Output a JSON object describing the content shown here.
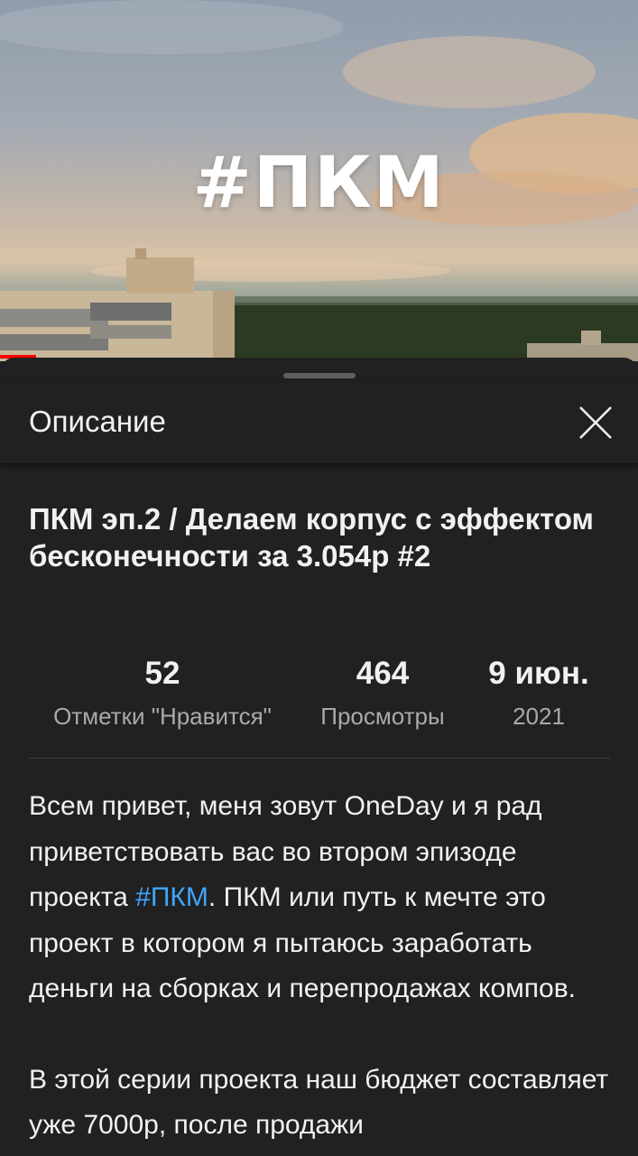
{
  "video": {
    "overlay_title": "#ПКМ",
    "progress_fraction": 0.056
  },
  "sheet": {
    "title": "Описание",
    "close_icon": "close-icon"
  },
  "video_title": "ПКМ эп.2 / Делаем корпус с эффектом бесконечности за 3.054р #2",
  "stats": {
    "likes": {
      "value": "52",
      "label": "Отметки \"Нравится\""
    },
    "views": {
      "value": "464",
      "label": "Просмотры"
    },
    "date": {
      "value": "9 июн.",
      "label": "2021"
    }
  },
  "description": {
    "p1_before": "Всем привет, меня зовут OneDay и я рад приветствовать вас во втором эпизоде проекта ",
    "p1_hashtag": "#ПКМ",
    "p1_after": ". ПКМ или путь к мечте это проект в котором я пытаюсь заработать деньги на сборках и перепродажах компов.",
    "p2": "В этой серии проекта наш бюджет составляет уже 7000р, после продажи"
  },
  "colors": {
    "background": "#212121",
    "link": "#3ea6ff",
    "progress": "#ff0000"
  }
}
